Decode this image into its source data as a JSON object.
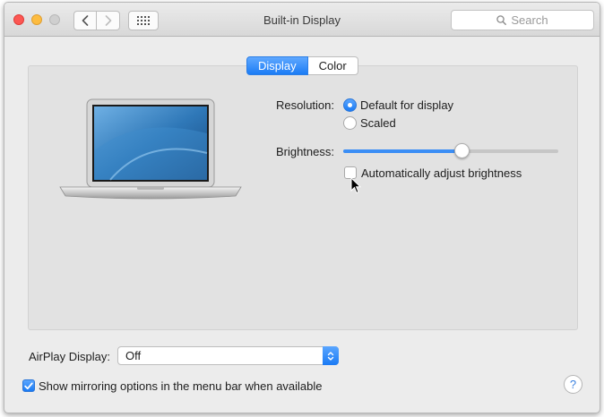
{
  "window": {
    "title": "Built-in Display",
    "search_placeholder": "Search"
  },
  "tabs": [
    {
      "label": "Display",
      "selected": true
    },
    {
      "label": "Color",
      "selected": false
    }
  ],
  "resolution": {
    "label": "Resolution:",
    "options": [
      {
        "label": "Default for display",
        "selected": true
      },
      {
        "label": "Scaled",
        "selected": false
      }
    ]
  },
  "brightness": {
    "label": "Brightness:",
    "level_percent": 55,
    "auto_adjust_label": "Automatically adjust brightness",
    "auto_adjust_checked": false
  },
  "airplay": {
    "label": "AirPlay Display:",
    "selected_value": "Off"
  },
  "mirroring": {
    "label": "Show mirroring options in the menu bar when available",
    "checked": true
  },
  "help": {
    "label": "?"
  },
  "colors": {
    "accent": "#1b7cf5",
    "close": "#fc5753",
    "minimize": "#fdbc40",
    "zoom": "#cfcfcf"
  },
  "icons": {
    "back": "chevron-left-icon",
    "forward": "chevron-right-icon",
    "show_all": "grid-icon",
    "search": "magnifier-icon",
    "display_preview": "laptop-icon"
  }
}
